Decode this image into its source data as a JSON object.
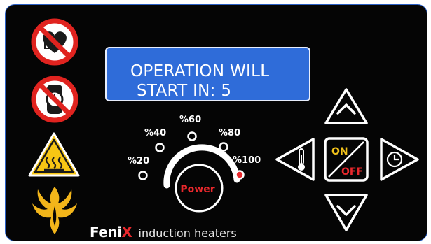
{
  "display": {
    "line1": "OPERATION WILL",
    "line2": "START IN: 5"
  },
  "power_dial": {
    "label": "Power",
    "levels": [
      "%20",
      "%40",
      "%60",
      "%80",
      "%100"
    ],
    "selected": "%100"
  },
  "buttons": {
    "up": "chevron-up-icon",
    "down": "chevron-down-icon",
    "temperature": "thermometer-icon",
    "timer": "clock-icon",
    "on_label": "ON",
    "off_label": "OFF"
  },
  "brand": {
    "name_main": "Feni",
    "name_accent": "X",
    "subtitle": "induction heaters"
  },
  "warnings": [
    "no-pacemaker-icon",
    "no-metal-watch-icon",
    "hot-surface-icon",
    "phoenix-logo-icon"
  ],
  "colors": {
    "panel": "#050505",
    "lcd": "#2f6cd9",
    "accent_red": "#e8282c",
    "on_yellow": "#f2c21b",
    "warning_yellow": "#f7c614"
  }
}
